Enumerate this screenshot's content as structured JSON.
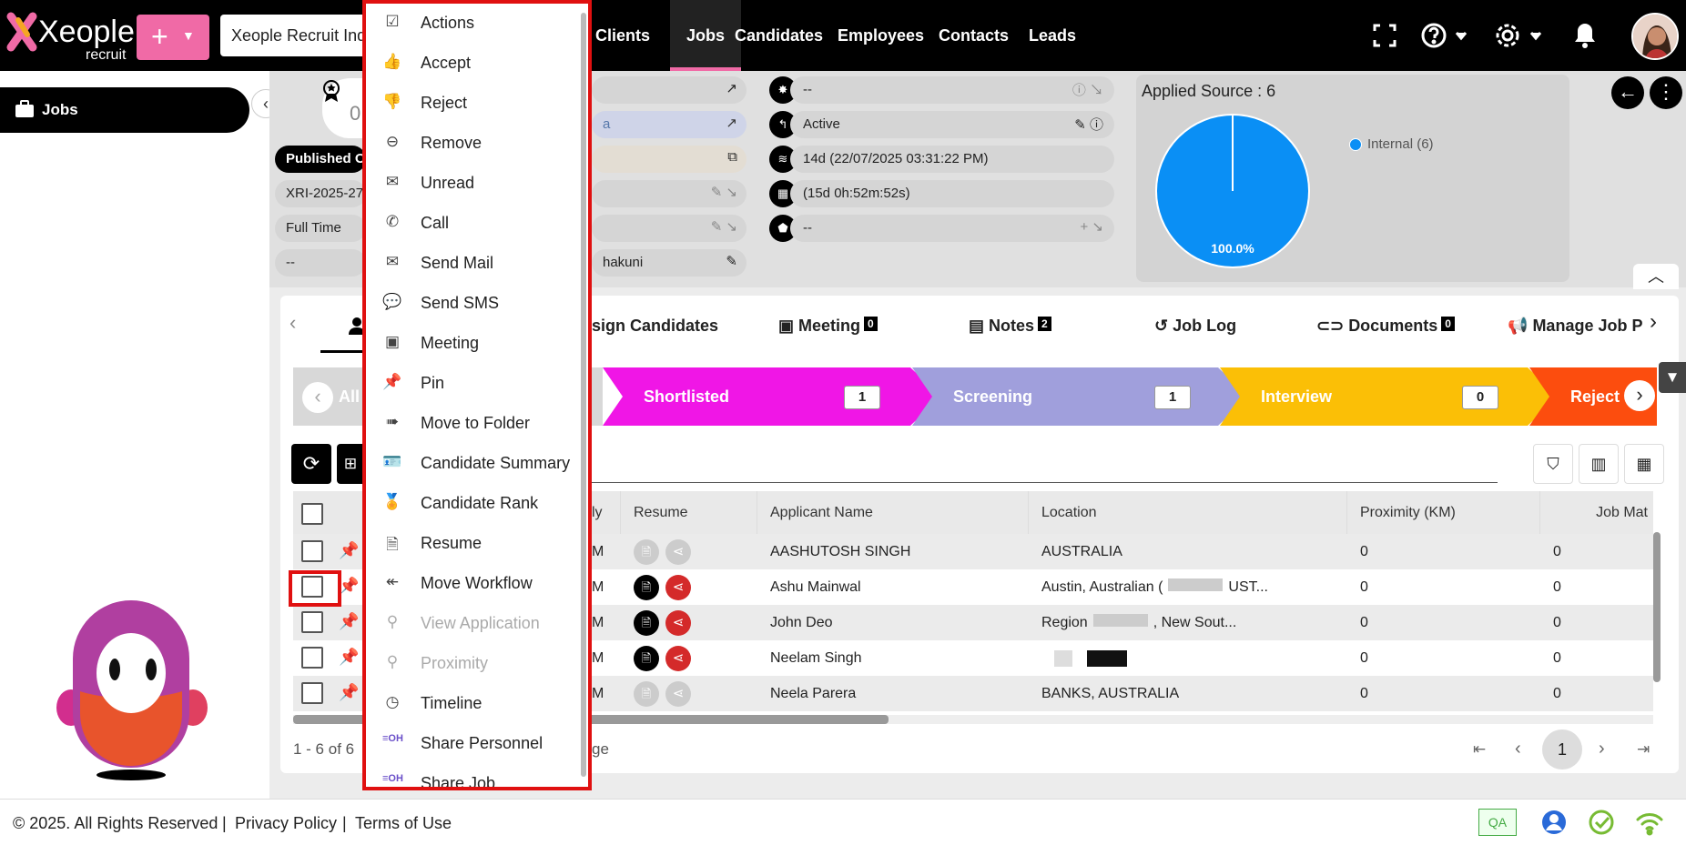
{
  "app": {
    "logo_text": "Xeople",
    "logo_sub": "recruit",
    "org_name": "Xeople Recruit Ind"
  },
  "nav": {
    "items": [
      "Clients",
      "Jobs",
      "Candidates",
      "Employees",
      "Contacts",
      "Leads"
    ],
    "active": "Jobs"
  },
  "sidebar": {
    "jobs_label": "Jobs"
  },
  "job": {
    "published_label": "Published On",
    "job_code": "XRI-2025-27",
    "job_type": "Full Time",
    "empty": "--",
    "link_frag": "a",
    "location_frag": "hakuni",
    "status": "Active",
    "age": "14d (22/07/2025 03:31:22 PM)",
    "remaining": "(15d 0h:52m:52s)",
    "tags": "--",
    "star_value": "--"
  },
  "source": {
    "title": "Applied Source : 6",
    "legend": "Internal (6)",
    "percent_label": "100.0%"
  },
  "chart_data": {
    "type": "pie",
    "title": "Applied Source : 6",
    "categories": [
      "Internal"
    ],
    "values": [
      6
    ],
    "percent": [
      100.0
    ],
    "legend_position": "right"
  },
  "tabs": [
    {
      "label": "Assign Candidates",
      "shown": "sign Candidates"
    },
    {
      "label": "Meeting",
      "badge": "0"
    },
    {
      "label": "Notes",
      "badge": "2"
    },
    {
      "label": "Job Log"
    },
    {
      "label": "Documents",
      "badge": "0"
    },
    {
      "label": "Manage Job P"
    }
  ],
  "stages": [
    {
      "label": "All",
      "count": ""
    },
    {
      "label": "Shortlisted",
      "count": "1",
      "color": "#f016e6"
    },
    {
      "label": "Screening",
      "count": "1",
      "color": "#a09fdc"
    },
    {
      "label": "Interview",
      "count": "0",
      "color": "#fbbf06"
    },
    {
      "label": "Reject",
      "count": "",
      "color": "#fc4d0e"
    }
  ],
  "table": {
    "headers": [
      "ly",
      "Resume",
      "Applicant Name",
      "Location",
      "Proximity (KM)",
      "Job Mat"
    ],
    "rows": [
      {
        "applied": "M",
        "name": "AASHUTOSH SINGH",
        "location": "AUSTRALIA",
        "proximity": "0",
        "match": "0",
        "resume": false
      },
      {
        "applied": "M",
        "name": "Ashu Mainwal",
        "location": "Austin, Australian (",
        "location_tail": "UST...",
        "proximity": "0",
        "match": "0",
        "resume": true
      },
      {
        "applied": "M",
        "name": "John Deo",
        "location": "Region",
        "location_tail": ", New Sout...",
        "proximity": "0",
        "match": "0",
        "resume": true
      },
      {
        "applied": "M",
        "name": "Neelam Singh",
        "location": "",
        "proximity": "0",
        "match": "0",
        "resume": true
      },
      {
        "applied": "M",
        "name": "Neela Parera",
        "location": "BANKS, AUSTRALIA",
        "proximity": "0",
        "match": "0",
        "resume": false
      }
    ],
    "pagination_text": "1 - 6 of 6",
    "page_label_frag": "ge",
    "current_page": "1"
  },
  "menu": {
    "items": [
      {
        "label": "Actions",
        "icon": "checklist-icon"
      },
      {
        "label": "Accept",
        "icon": "thumbs-up-icon"
      },
      {
        "label": "Reject",
        "icon": "thumbs-down-icon"
      },
      {
        "label": "Remove",
        "icon": "remove-circle-icon"
      },
      {
        "label": "Unread",
        "icon": "open-mail-icon"
      },
      {
        "label": "Call",
        "icon": "phone-icon"
      },
      {
        "label": "Send Mail",
        "icon": "mail-icon"
      },
      {
        "label": "Send SMS",
        "icon": "sms-icon"
      },
      {
        "label": "Meeting",
        "icon": "meeting-icon"
      },
      {
        "label": "Pin",
        "icon": "pin-icon"
      },
      {
        "label": "Move to Folder",
        "icon": "folder-move-icon"
      },
      {
        "label": "Candidate Summary",
        "icon": "id-card-icon"
      },
      {
        "label": "Candidate Rank",
        "icon": "rank-icon"
      },
      {
        "label": "Resume",
        "icon": "document-icon"
      },
      {
        "label": "Move Workflow",
        "icon": "reply-all-icon"
      },
      {
        "label": "View Application",
        "icon": "location-pin-icon",
        "disabled": true
      },
      {
        "label": "Proximity",
        "icon": "location-pin-icon",
        "disabled": true
      },
      {
        "label": "Timeline",
        "icon": "clock-icon"
      },
      {
        "label": "Share Personnel",
        "icon": "eoh-icon"
      },
      {
        "label": "Share Job",
        "icon": "eoh-icon"
      }
    ]
  },
  "footer": {
    "copyright": "© 2025. All Rights Reserved",
    "privacy": "Privacy Policy",
    "terms": "Terms of Use",
    "env_badge": "QA"
  }
}
